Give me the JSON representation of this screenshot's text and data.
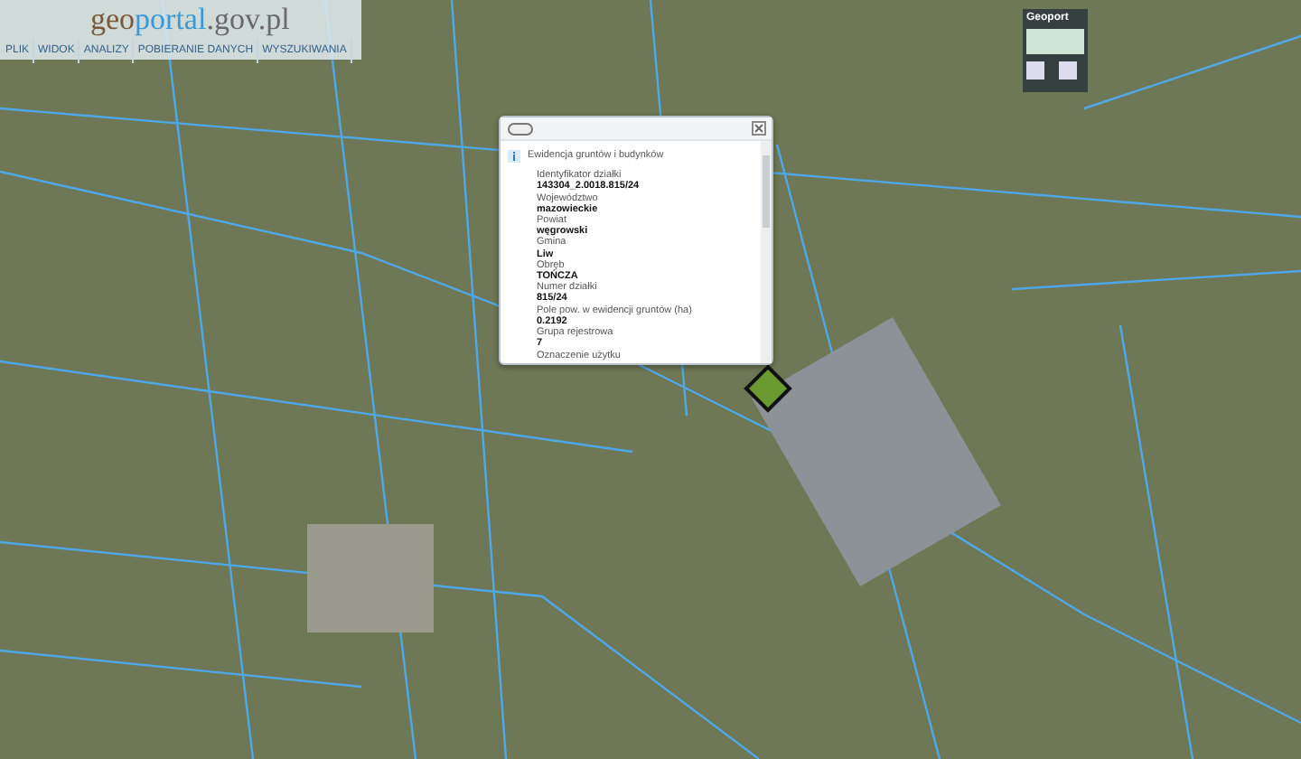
{
  "header": {
    "logo": {
      "prefix": "geo",
      "main": "portal",
      "suffix": ".gov.pl"
    },
    "menu": [
      "PLIK",
      "WIDOK",
      "ANALIZY",
      "POBIERANIE DANYCH",
      "WYSZUKIWANIA"
    ]
  },
  "overview": {
    "title": "Geoport"
  },
  "popup": {
    "section_title": "Ewidencja gruntów i budynków",
    "fields": [
      {
        "label": "Identyfikator działki",
        "value": "143304_2.0018.815/24"
      },
      {
        "label": "Województwo",
        "value": "mazowieckie"
      },
      {
        "label": "Powiat",
        "value": "węgrowski"
      },
      {
        "label": "Gmina",
        "value": "Liw"
      },
      {
        "label": "Obręb",
        "value": "TOŃCZA"
      },
      {
        "label": "Numer działki",
        "value": "815/24"
      },
      {
        "label": "Pole pow. w ewidencji gruntów (ha)",
        "value": "0.2192"
      },
      {
        "label": "Grupa rejestrowa",
        "value": "7"
      },
      {
        "label": "Oznaczenie użytku"
      }
    ]
  }
}
